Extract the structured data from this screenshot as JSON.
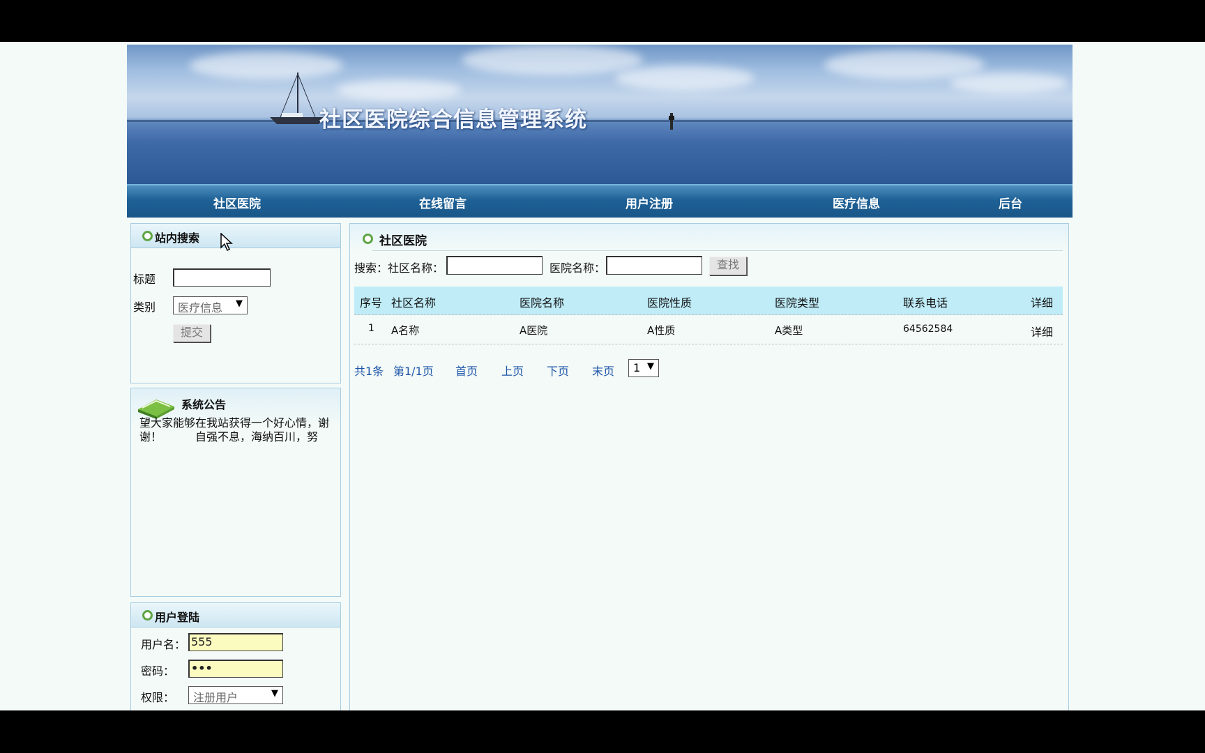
{
  "banner": {
    "title": "社区医院综合信息管理系统"
  },
  "nav": {
    "items": [
      {
        "label": "社区医院"
      },
      {
        "label": "在线留言"
      },
      {
        "label": "用户注册"
      },
      {
        "label": "医疗信息"
      },
      {
        "label": "后台"
      }
    ]
  },
  "site_search": {
    "title": "站内搜索",
    "title_label": "标题",
    "title_value": "",
    "category_label": "类别",
    "category_selected": "医疗信息",
    "submit_label": "提交"
  },
  "notice": {
    "title": "系统公告",
    "text": "望大家能够在我站获得一个好心情，谢谢！　　　自强不息，海纳百川，努"
  },
  "login": {
    "title": "用户登陆",
    "username_label": "用户名：",
    "username_value": "555",
    "password_label": "密码：",
    "password_value": "•••",
    "role_label": "权限：",
    "role_selected": "注册用户"
  },
  "main": {
    "title": "社区医院",
    "search": {
      "prefix": "搜索：",
      "community_label": "社区名称：",
      "community_value": "",
      "hospital_label": "医院名称：",
      "hospital_value": "",
      "button_label": "查找"
    },
    "table": {
      "headers": [
        "序号",
        "社区名称",
        "医院名称",
        "医院性质",
        "医院类型",
        "联系电话",
        "详细"
      ],
      "rows": [
        [
          "1",
          "A名称",
          "A医院",
          "A性质",
          "A类型",
          "64562584",
          "详细"
        ]
      ]
    },
    "pager": {
      "total": "共1条",
      "page": "第1/1页",
      "first": "首页",
      "prev": "上页",
      "next": "下页",
      "last": "末页",
      "select_value": "1"
    }
  }
}
